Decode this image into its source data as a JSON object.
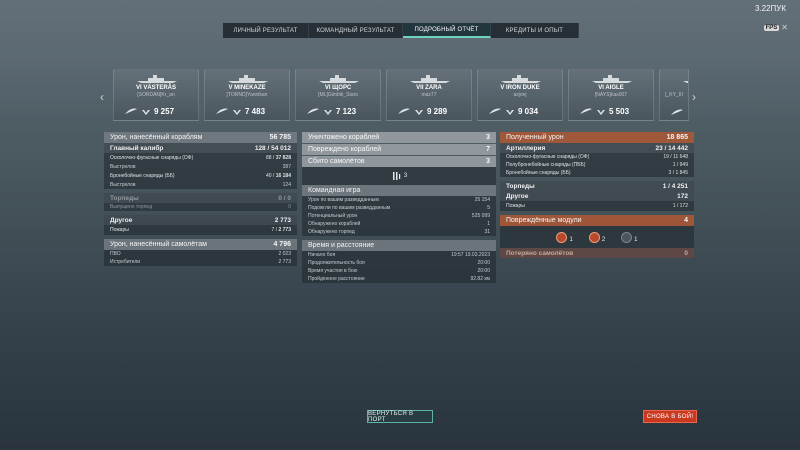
{
  "clock": "3.22ПУК",
  "top_badge": "FPS",
  "tabs": [
    {
      "label": "ЛИЧНЫЙ РЕЗУЛЬТАТ"
    },
    {
      "label": "КОМАНДНЫЙ РЕЗУЛЬТАТ"
    },
    {
      "label": "ПОДРОБНЫЙ ОТЧЁТ"
    },
    {
      "label": "КРЕДИТЫ И ОПЫТ"
    }
  ],
  "ships": [
    {
      "name": "VI VÄSTERÅS",
      "player": "[SORDAN]Kr_an",
      "score": "9 257"
    },
    {
      "name": "V MINEKAZE",
      "player": "[TORND]Yannikan",
      "score": "7 483"
    },
    {
      "name": "VI ЩОРС",
      "player": "[ML]Gimbik_Stars",
      "score": "7 123"
    },
    {
      "name": "VII ZARA",
      "player": "maz77",
      "score": "9 289"
    },
    {
      "name": "V IRON DUKE",
      "player": "asjonj",
      "score": "9 034"
    },
    {
      "name": "VI AIGLE",
      "player": "[NAYS]kas007",
      "score": "5 503"
    },
    {
      "name": "",
      "player": "[_KY_III",
      "score": ""
    }
  ],
  "left": {
    "header": {
      "label": "Урон, нанесённый кораблям",
      "value": "56 785"
    },
    "main_caliber": {
      "label": "Главный калибр",
      "hits": "128",
      "shots": "54 012"
    },
    "he": {
      "label": "Осколочно-фугасные снаряды (ОФ)",
      "hits": "88",
      "total": "37 828"
    },
    "he_shots": {
      "label": "Выстрелов",
      "value": "387"
    },
    "ap": {
      "label": "Бронебойные снаряды (ББ)",
      "hits": "40",
      "total": "16 184"
    },
    "ap_shots": {
      "label": "Выстрелов",
      "value": "124"
    },
    "torpedoes": {
      "label": "Торпеды",
      "value": "0 / 0"
    },
    "torp_launched": {
      "label": "Выпущено торпед",
      "value": "0"
    },
    "other": {
      "label": "Другое",
      "value": "2 773"
    },
    "fires": {
      "label": "Пожары",
      "hits": "7",
      "total": "2 773"
    },
    "planes_header": {
      "label": "Урон, нанесённый самолётам",
      "value": "4 796"
    },
    "aa": {
      "label": "ПВО",
      "value": "2 023"
    },
    "fighters": {
      "label": "Истребители",
      "value": "2 773"
    }
  },
  "mid": {
    "destroyed": {
      "label": "Уничтожено кораблей",
      "value": "3"
    },
    "damaged": {
      "label": "Повреждено кораблей",
      "value": "7"
    },
    "planes": {
      "label": "Сбито самолётов",
      "value": "3"
    },
    "planes_count": "3",
    "team_header": "Командная игра",
    "spot_damage": {
      "label": "Урон по вашим разведданным",
      "value": "25 154"
    },
    "spot_fire": {
      "label": "Подожгли по вашим разведданным",
      "value": "5"
    },
    "potential": {
      "label": "Потенциальный урон",
      "value": "525 099"
    },
    "spotted_ships": {
      "label": "Обнаружено кораблей",
      "value": "1"
    },
    "spotted_torps": {
      "label": "Обнаружено торпед",
      "value": "31"
    },
    "time_header": "Время и расстояние",
    "start": {
      "label": "Начало боя",
      "value": "19:57  19.03.2023"
    },
    "duration": {
      "label": "Продолжительность боя",
      "value": "20:00"
    },
    "time_alive": {
      "label": "Время участия в бою",
      "value": "20:00"
    },
    "distance": {
      "label": "Пройденное расстояние",
      "value": "92.82 км"
    }
  },
  "right": {
    "header": {
      "label": "Полученный урон",
      "value": "18 865"
    },
    "artillery": {
      "label": "Артиллерия",
      "hits": "23",
      "total": "14 442"
    },
    "he": {
      "label": "Осколочно-фугасные снаряды (ОФ)",
      "value": "19 / 11 648"
    },
    "sap": {
      "label": "Полубронебойные снаряды (ПББ)",
      "value": "1 / 949"
    },
    "ap": {
      "label": "Бронебойные снаряды (ББ)",
      "value": "3 / 1 845"
    },
    "torpedoes": {
      "label": "Торпеды",
      "value": "1 / 4 251"
    },
    "other": {
      "label": "Другое",
      "value": "172"
    },
    "fires": {
      "label": "Пожары",
      "value": "1 / 172"
    },
    "modules_header": {
      "label": "Повреждённые модули",
      "value": "4"
    },
    "modules": [
      {
        "icon": "gun-module-icon",
        "count": "1"
      },
      {
        "icon": "engine-module-icon",
        "count": "2"
      },
      {
        "icon": "rudder-module-icon",
        "count": "1"
      }
    ],
    "lost_planes": {
      "label": "Потеряно самолётов",
      "value": "0"
    }
  },
  "buttons": {
    "port": "ВЕРНУТЬСЯ В ПОРТ",
    "battle": "СНОВА В БОЙ!"
  },
  "colors": {
    "accent_teal": "#6fd3c0",
    "received_damage": "#ac5834",
    "battle_button": "#c8391f"
  }
}
